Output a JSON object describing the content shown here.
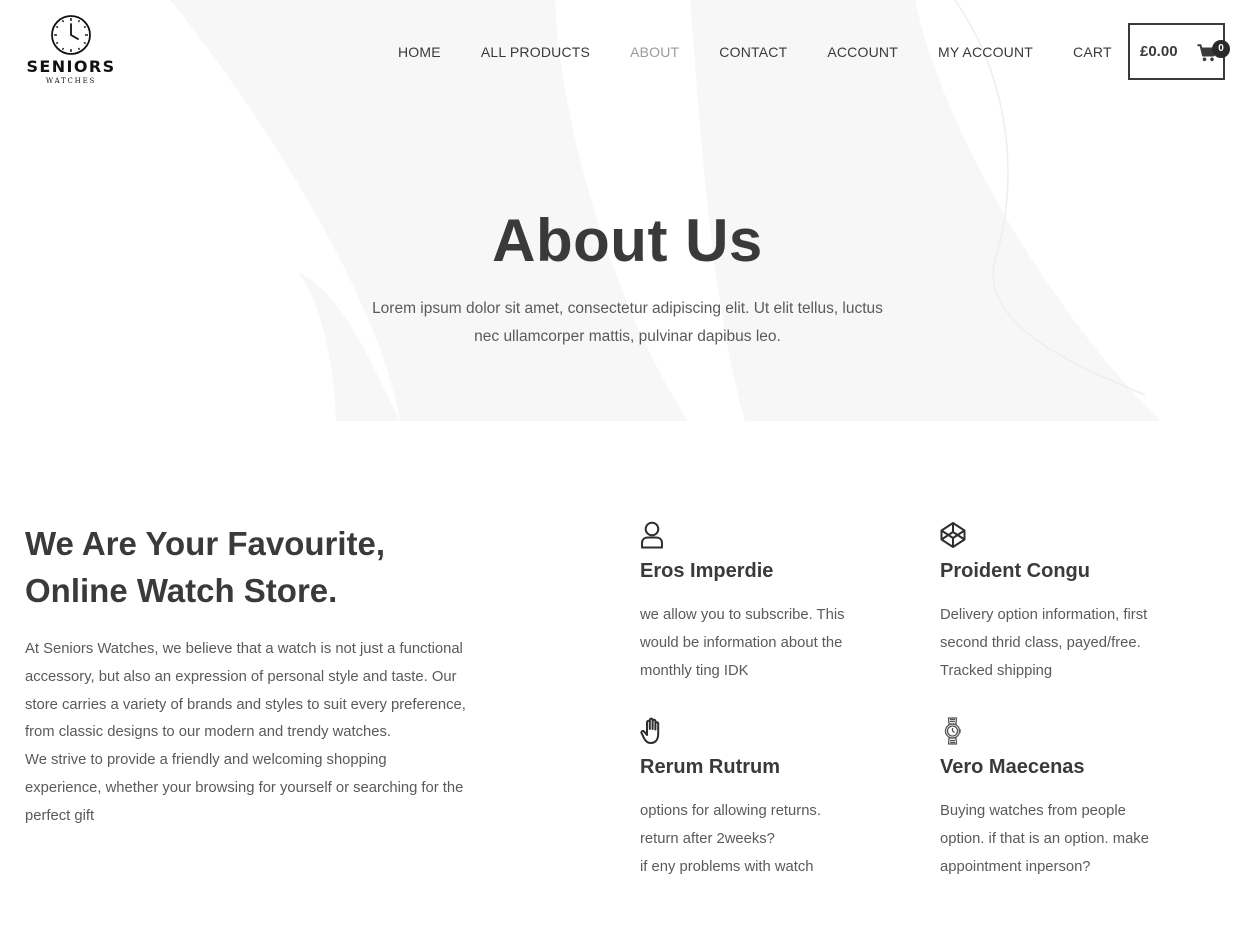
{
  "brand": {
    "name": "SENIORS",
    "tagline": "WATCHES",
    "logo_icon": "clock-icon"
  },
  "nav": {
    "items": [
      {
        "label": "HOME",
        "active": false
      },
      {
        "label": "ALL PRODUCTS",
        "active": false
      },
      {
        "label": "ABOUT",
        "active": true
      },
      {
        "label": "CONTACT",
        "active": false
      },
      {
        "label": "ACCOUNT",
        "active": false
      },
      {
        "label": "MY ACCOUNT",
        "active": false
      },
      {
        "label": "CART",
        "active": false
      }
    ]
  },
  "cart": {
    "total": "£0.00",
    "count": "0",
    "icon": "shopping-cart-icon"
  },
  "hero": {
    "title": "About Us",
    "subtitle_lines": [
      "Lorem ipsum dolor sit amet, consectetur adipiscing elit. Ut elit tellus, luctus",
      "nec ullamcorper mattis, pulvinar dapibus leo."
    ]
  },
  "about": {
    "title_lines": [
      "We Are Your Favourite,",
      "Online Watch Store."
    ],
    "paragraph_lines": [
      "At Seniors Watches,  we believe that a watch is not just a functional",
      "accessory, but also an expression of personal style and taste. Our",
      "store carries a variety of brands and styles to suit every preference,",
      "from classic designs to our modern and trendy watches.",
      "We strive to provide a friendly and welcoming shopping",
      "experience, whether your browsing for yourself or searching for the",
      "perfect gift"
    ]
  },
  "features": [
    {
      "icon": "user-icon",
      "title": "Eros Imperdie",
      "lines": [
        "we allow you to subscribe. This",
        "would be information about the",
        "monthly ting IDK"
      ]
    },
    {
      "icon": "codepen-cube-icon",
      "title": "Proident Congu",
      "lines": [
        "Delivery option information, first",
        "second thrid class, payed/free.",
        "Tracked shipping"
      ]
    },
    {
      "icon": "hand-icon",
      "title": "Rerum Rutrum",
      "lines": [
        "options for allowing returns.",
        "return after 2weeks?",
        "if eny problems with watch"
      ]
    },
    {
      "icon": "wristwatch-icon",
      "title": "Vero Maecenas",
      "lines": [
        "Buying watches from people",
        "option. if that is an option. make",
        "appointment inperson?"
      ]
    }
  ],
  "colors": {
    "text_dark": "#3a3a3a",
    "text_body": "#5a5a5a",
    "nav_active": "#9a9a9a",
    "hero_shape": "#f7f7f7"
  }
}
